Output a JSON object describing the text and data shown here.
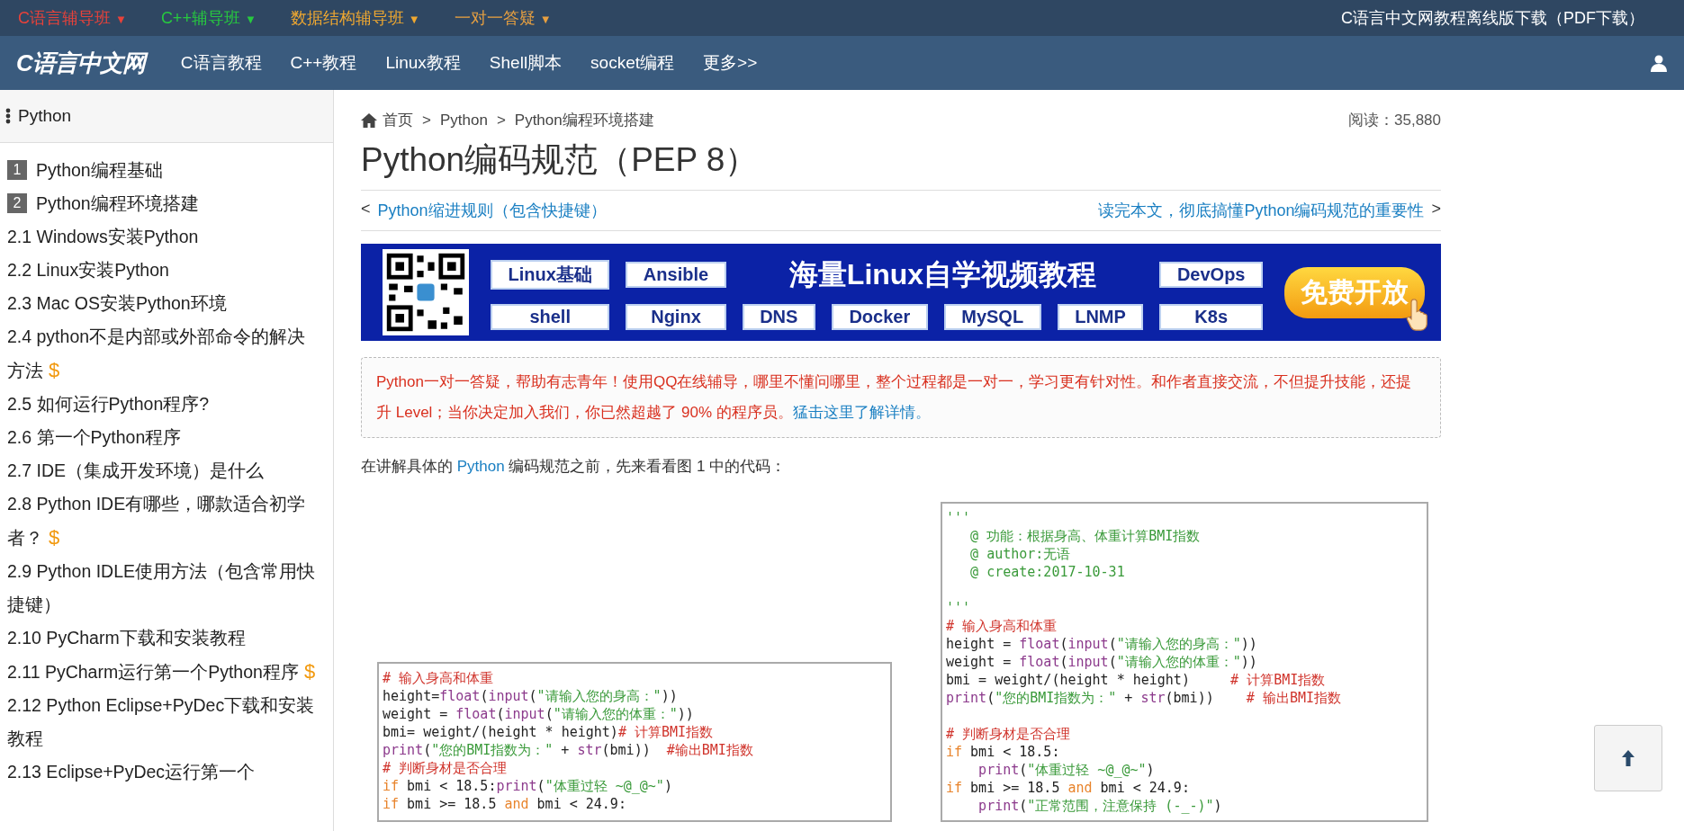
{
  "top_bar": {
    "courses": [
      {
        "label": "C语言辅导班",
        "caret": "▼",
        "color": "#e8423a"
      },
      {
        "label": "C++辅导班",
        "caret": "▼",
        "color": "#27c93f"
      },
      {
        "label": "数据结构辅导班",
        "caret": "▼",
        "color": "#f0a830"
      },
      {
        "label": "一对一答疑",
        "caret": "▼",
        "color": "#e8a040"
      }
    ],
    "download": "C语言中文网教程离线版下载（PDF下载）"
  },
  "nav": {
    "logo": "C语言中文网",
    "links": [
      "C语言教程",
      "C++教程",
      "Linux教程",
      "Shell脚本",
      "socket编程",
      "更多>>"
    ]
  },
  "sidebar": {
    "title": "Python",
    "items": [
      {
        "kind": "chapter",
        "number": "1",
        "label": "Python编程基础",
        "paid": false
      },
      {
        "kind": "chapter",
        "number": "2",
        "label": "Python编程环境搭建",
        "paid": false
      },
      {
        "kind": "section",
        "label": "2.1 Windows安装Python",
        "paid": false
      },
      {
        "kind": "section",
        "label": "2.2 Linux安装Python",
        "paid": false
      },
      {
        "kind": "section",
        "label": "2.3 Mac OS安装Python环境",
        "paid": false
      },
      {
        "kind": "section",
        "label": "2.4 python不是内部或外部命令的解决方法",
        "paid": true
      },
      {
        "kind": "section",
        "label": "2.5 如何运行Python程序?",
        "paid": false
      },
      {
        "kind": "section",
        "label": "2.6 第一个Python程序",
        "paid": false
      },
      {
        "kind": "section",
        "label": "2.7 IDE（集成开发环境）是什么",
        "paid": false
      },
      {
        "kind": "section",
        "label": "2.8 Python IDE有哪些，哪款适合初学者？",
        "paid": true
      },
      {
        "kind": "section",
        "label": "2.9 Python IDLE使用方法（包含常用快捷键）",
        "paid": false
      },
      {
        "kind": "section",
        "label": "2.10 PyCharm下载和安装教程",
        "paid": false
      },
      {
        "kind": "section",
        "label": "2.11 PyCharm运行第一个Python程序",
        "paid": true
      },
      {
        "kind": "section",
        "label": "2.12 Python Eclipse+PyDec下载和安装教程",
        "paid": false
      },
      {
        "kind": "section",
        "label": "2.13 Eclipse+PyDec运行第一个",
        "paid": false
      }
    ],
    "paid_mark": "$"
  },
  "breadcrumb": {
    "items": [
      "首页",
      "Python",
      "Python编程环境搭建"
    ],
    "separator": ">",
    "reads": "阅读：35,880"
  },
  "title": "Python编码规范（PEP 8）",
  "article_nav": {
    "prev_arrow": "<",
    "prev": "Python缩进规则（包含快捷键）",
    "next": "读完本文，彻底搞懂Python编码规范的重要性",
    "next_arrow": ">"
  },
  "banner": {
    "row1_left": [
      "Linux基础",
      "Ansible"
    ],
    "headline": "海量Linux自学视频教程",
    "row1_right": [
      "DevOps"
    ],
    "row2": [
      "shell",
      "Nginx",
      "DNS",
      "Docker",
      "MySQL",
      "LNMP",
      "K8s"
    ],
    "cta": "免费开放"
  },
  "notice": {
    "text": "Python一对一答疑，帮助有志青年！使用QQ在线辅导，哪里不懂问哪里，整个过程都是一对一，学习更有针对性。和作者直接交流，不但提升技能，还提升 Level；当你决定加入我们，你已然超越了 90% 的程序员。",
    "link": "猛击这里了解详情。"
  },
  "intro": {
    "before": "在讲解具体的 ",
    "link": "Python",
    "after": " 编码规范之前，先来看看图 1 中的代码："
  },
  "code_figures": [
    {
      "lines": [
        {
          "kind": "code",
          "segments": [
            {
              "kind": "comment",
              "text": "# 输入身高和体重"
            }
          ]
        },
        {
          "kind": "code",
          "segments": [
            {
              "kind": "plain",
              "text": "height="
            },
            {
              "kind": "builtin",
              "text": "float"
            },
            {
              "kind": "plain",
              "text": "("
            },
            {
              "kind": "builtin",
              "text": "input"
            },
            {
              "kind": "plain",
              "text": "("
            },
            {
              "kind": "string",
              "text": "\"请输入您的身高：\""
            },
            {
              "kind": "plain",
              "text": "))"
            }
          ]
        },
        {
          "kind": "code",
          "segments": [
            {
              "kind": "plain",
              "text": "weight = "
            },
            {
              "kind": "builtin",
              "text": "float"
            },
            {
              "kind": "plain",
              "text": "("
            },
            {
              "kind": "builtin",
              "text": "input"
            },
            {
              "kind": "plain",
              "text": "("
            },
            {
              "kind": "string",
              "text": "\"请输入您的体重：\""
            },
            {
              "kind": "plain",
              "text": "))"
            }
          ]
        },
        {
          "kind": "code",
          "segments": [
            {
              "kind": "plain",
              "text": "bmi= weight/(height * height)"
            },
            {
              "kind": "comment",
              "text": "# 计算BMI指数"
            }
          ]
        },
        {
          "kind": "code",
          "segments": [
            {
              "kind": "builtin",
              "text": "print"
            },
            {
              "kind": "plain",
              "text": "("
            },
            {
              "kind": "string",
              "text": "\"您的BMI指数为：\""
            },
            {
              "kind": "plain",
              "text": " + "
            },
            {
              "kind": "builtin",
              "text": "str"
            },
            {
              "kind": "plain",
              "text": "(bmi))  "
            },
            {
              "kind": "comment",
              "text": "#输出BMI指数"
            }
          ]
        },
        {
          "kind": "code",
          "segments": [
            {
              "kind": "comment",
              "text": "# 判断身材是否合理"
            }
          ]
        },
        {
          "kind": "code",
          "segments": [
            {
              "kind": "keyword",
              "text": "if"
            },
            {
              "kind": "plain",
              "text": " bmi < 18.5:"
            },
            {
              "kind": "builtin",
              "text": "print"
            },
            {
              "kind": "plain",
              "text": "("
            },
            {
              "kind": "string",
              "text": "\"体重过轻 ~@_@~\""
            },
            {
              "kind": "plain",
              "text": ")"
            }
          ]
        },
        {
          "kind": "code",
          "segments": [
            {
              "kind": "keyword",
              "text": "if"
            },
            {
              "kind": "plain",
              "text": " bmi >= 18.5 "
            },
            {
              "kind": "keyword",
              "text": "and"
            },
            {
              "kind": "plain",
              "text": " bmi < 24.9:"
            }
          ]
        }
      ]
    },
    {
      "lines": [
        {
          "kind": "code",
          "segments": [
            {
              "kind": "string",
              "text": "'''"
            }
          ]
        },
        {
          "kind": "code",
          "segments": [
            {
              "kind": "string",
              "text": "   @ 功能：根据身高、体重计算BMI指数"
            }
          ]
        },
        {
          "kind": "code",
          "segments": [
            {
              "kind": "string",
              "text": "   @ author:无语"
            }
          ]
        },
        {
          "kind": "code",
          "segments": [
            {
              "kind": "string",
              "text": "   @ create:2017-10-31"
            }
          ]
        },
        {
          "kind": "blank"
        },
        {
          "kind": "code",
          "segments": [
            {
              "kind": "string",
              "text": "'''"
            }
          ]
        },
        {
          "kind": "code",
          "segments": [
            {
              "kind": "comment",
              "text": "# 输入身高和体重"
            }
          ]
        },
        {
          "kind": "code",
          "segments": [
            {
              "kind": "plain",
              "text": "height = "
            },
            {
              "kind": "builtin",
              "text": "float"
            },
            {
              "kind": "plain",
              "text": "("
            },
            {
              "kind": "builtin",
              "text": "input"
            },
            {
              "kind": "plain",
              "text": "("
            },
            {
              "kind": "string",
              "text": "\"请输入您的身高：\""
            },
            {
              "kind": "plain",
              "text": "))"
            }
          ]
        },
        {
          "kind": "code",
          "segments": [
            {
              "kind": "plain",
              "text": "weight = "
            },
            {
              "kind": "builtin",
              "text": "float"
            },
            {
              "kind": "plain",
              "text": "("
            },
            {
              "kind": "builtin",
              "text": "input"
            },
            {
              "kind": "plain",
              "text": "("
            },
            {
              "kind": "string",
              "text": "\"请输入您的体重：\""
            },
            {
              "kind": "plain",
              "text": "))"
            }
          ]
        },
        {
          "kind": "code",
          "segments": [
            {
              "kind": "plain",
              "text": "bmi = weight/(height * height)     "
            },
            {
              "kind": "comment",
              "text": "# 计算BMI指数"
            }
          ]
        },
        {
          "kind": "code",
          "segments": [
            {
              "kind": "builtin",
              "text": "print"
            },
            {
              "kind": "plain",
              "text": "("
            },
            {
              "kind": "string",
              "text": "\"您的BMI指数为：\""
            },
            {
              "kind": "plain",
              "text": " + "
            },
            {
              "kind": "builtin",
              "text": "str"
            },
            {
              "kind": "plain",
              "text": "(bmi))    "
            },
            {
              "kind": "comment",
              "text": "# 输出BMI指数"
            }
          ]
        },
        {
          "kind": "blank"
        },
        {
          "kind": "code",
          "segments": [
            {
              "kind": "comment",
              "text": "# 判断身材是否合理"
            }
          ]
        },
        {
          "kind": "code",
          "segments": [
            {
              "kind": "keyword",
              "text": "if"
            },
            {
              "kind": "plain",
              "text": " bmi < 18.5:"
            }
          ]
        },
        {
          "kind": "indented",
          "segments": [
            {
              "kind": "builtin",
              "text": "print"
            },
            {
              "kind": "plain",
              "text": "("
            },
            {
              "kind": "string",
              "text": "\"体重过轻 ~@_@~\""
            },
            {
              "kind": "plain",
              "text": ")"
            }
          ]
        },
        {
          "kind": "code",
          "segments": [
            {
              "kind": "keyword",
              "text": "if"
            },
            {
              "kind": "plain",
              "text": " bmi >= 18.5 "
            },
            {
              "kind": "keyword",
              "text": "and"
            },
            {
              "kind": "plain",
              "text": " bmi < 24.9:"
            }
          ]
        },
        {
          "kind": "indented",
          "segments": [
            {
              "kind": "builtin",
              "text": "print"
            },
            {
              "kind": "plain",
              "text": "("
            },
            {
              "kind": "string",
              "text": "\"正常范围，注意保持 (-_-)\""
            },
            {
              "kind": "plain",
              "text": ")"
            }
          ]
        }
      ]
    }
  ]
}
